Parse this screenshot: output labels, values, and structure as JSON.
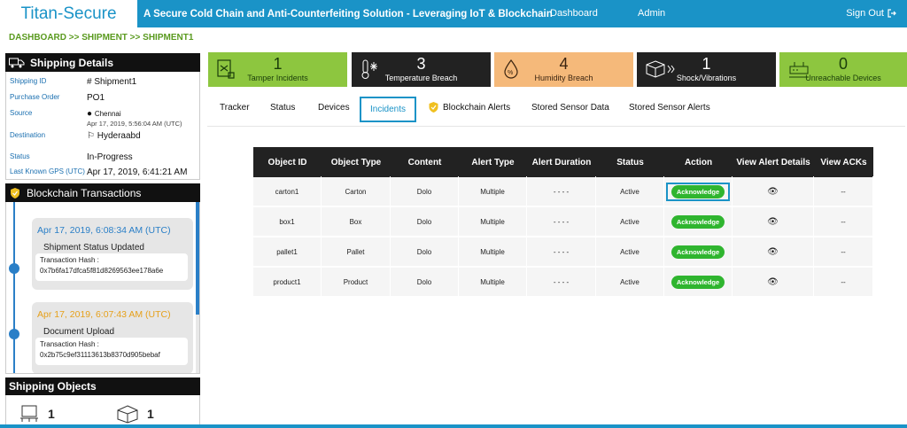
{
  "header": {
    "brand": "Titan-Secure",
    "tagline": "A Secure Cold Chain and Anti-Counterfeiting Solution - Leveraging IoT & Blockchain",
    "nav": [
      "Dashboard",
      "Admin"
    ],
    "signout": "Sign Out"
  },
  "breadcrumb": "DASHBOARD >> SHIPMENT >> SHIPMENT1",
  "shipping_details": {
    "title": "Shipping Details",
    "rows": [
      {
        "label": "Shipping ID",
        "value": "# Shipment1"
      },
      {
        "label": "Purchase Order",
        "value": "PO1"
      },
      {
        "label": "Source",
        "value": "Chennai",
        "sub": "Apr 17, 2019, 5:56:04 AM (UTC)"
      },
      {
        "label": "Destination",
        "value": "Hyderaabd"
      },
      {
        "label": "Status",
        "value": "In-Progress"
      },
      {
        "label": "Last Known GPS (UTC)",
        "value": "Apr 17, 2019, 6:41:21 AM"
      }
    ]
  },
  "blockchain": {
    "title": "Blockchain Transactions",
    "hash_label": "Transaction Hash :",
    "items": [
      {
        "date": "Apr 17, 2019, 6:08:34 AM (UTC)",
        "title": "Shipment Status Updated",
        "hash": "0x7b6fa17dfca5f81d8269563ee178a6e"
      },
      {
        "date": "Apr 17, 2019, 6:07:43 AM (UTC)",
        "title": "Document Upload",
        "hash": "0x2b75c9ef31113613b8370d905bebaf"
      }
    ]
  },
  "shipping_objects": {
    "title": "Shipping Objects",
    "counts": [
      "1",
      "1"
    ]
  },
  "tiles": [
    {
      "value": "1",
      "label": "Tamper Incidents",
      "bg": "#8dc63f",
      "fg": "#1a3d0a",
      "icon": "tamper-icon"
    },
    {
      "value": "3",
      "label": "Temperature Breach",
      "bg": "#222222",
      "fg": "#ffffff",
      "icon": "thermometer-snowflake-icon"
    },
    {
      "value": "4",
      "label": "Humidity Breach",
      "bg": "#f5b97a",
      "fg": "#3a2410",
      "icon": "humidity-drop-icon"
    },
    {
      "value": "1",
      "label": "Shock/Vibrations",
      "bg": "#222222",
      "fg": "#ffffff",
      "icon": "shock-box-icon"
    },
    {
      "value": "0",
      "label": "Unreachable Devices",
      "bg": "#8dc63f",
      "fg": "#1a3d0a",
      "icon": "unreachable-device-icon"
    }
  ],
  "tabs": [
    "Tracker",
    "Status",
    "Devices",
    "Incidents",
    "Blockchain Alerts",
    "Stored Sensor Data",
    "Stored Sensor Alerts"
  ],
  "table": {
    "headers": [
      "Object ID",
      "Object Type",
      "Content",
      "Alert Type",
      "Alert Duration",
      "Status",
      "Action",
      "View Alert Details",
      "View ACKs"
    ],
    "rows": [
      {
        "id": "carton1",
        "type": "Carton",
        "content": "Dolo",
        "alert": "Multiple",
        "duration": "- - - -",
        "status": "Active",
        "action": "Acknowledge",
        "acks": "--"
      },
      {
        "id": "box1",
        "type": "Box",
        "content": "Dolo",
        "alert": "Multiple",
        "duration": "- - - -",
        "status": "Active",
        "action": "Acknowledge",
        "acks": "--"
      },
      {
        "id": "pallet1",
        "type": "Pallet",
        "content": "Dolo",
        "alert": "Multiple",
        "duration": "- - - -",
        "status": "Active",
        "action": "Acknowledge",
        "acks": "--"
      },
      {
        "id": "product1",
        "type": "Product",
        "content": "Dolo",
        "alert": "Multiple",
        "duration": "- - - -",
        "status": "Active",
        "action": "Acknowledge",
        "acks": "--"
      }
    ]
  },
  "colors": {
    "accent": "#1a93c7",
    "green": "#8dc63f",
    "button": "#2fb52f",
    "timeline_date": "#2a7fc7",
    "timeline_date_alt": "#e6a01a"
  }
}
